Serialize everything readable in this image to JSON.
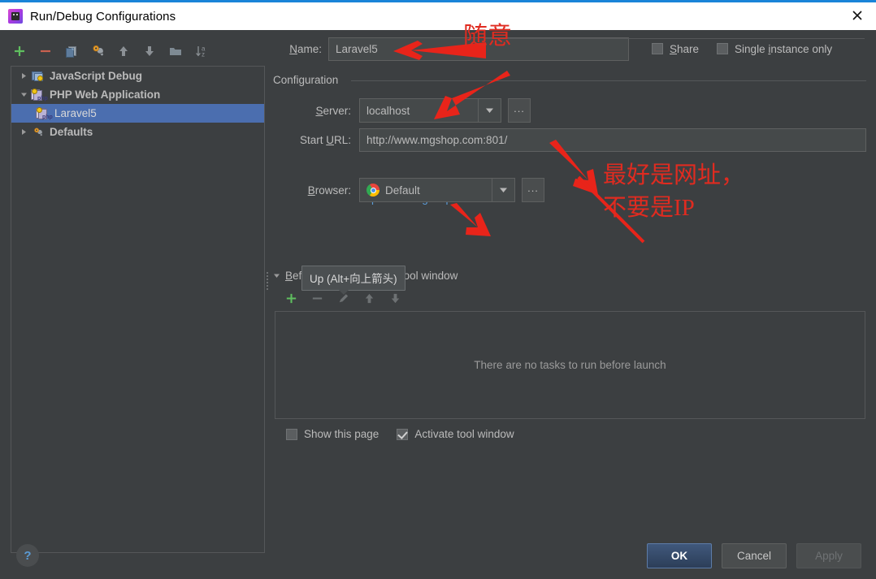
{
  "window": {
    "title": "Run/Debug Configurations",
    "icon": "phpstorm-icon",
    "close_icon": "close-icon"
  },
  "toolbar": {
    "buttons": [
      {
        "name": "add-configuration-button",
        "icon": "plus-icon"
      },
      {
        "name": "remove-configuration-button",
        "icon": "minus-icon"
      },
      {
        "name": "copy-configuration-button",
        "icon": "copy-icon"
      },
      {
        "name": "edit-defaults-button",
        "icon": "wrench-icon"
      },
      {
        "name": "move-up-button",
        "icon": "arrow-up-icon"
      },
      {
        "name": "move-down-button",
        "icon": "arrow-down-icon"
      },
      {
        "name": "create-folder-button",
        "icon": "folder-icon"
      },
      {
        "name": "sort-configurations-button",
        "icon": "sort-az-icon"
      }
    ]
  },
  "tree": {
    "items": [
      {
        "label": "JavaScript Debug",
        "icon": "javascript-debug-icon",
        "expanded": false,
        "selected": false,
        "indent": 0
      },
      {
        "label": "PHP Web Application",
        "icon": "php-web-application-icon",
        "expanded": true,
        "selected": false,
        "indent": 0
      },
      {
        "label": "Laravel5",
        "icon": "php-config-icon",
        "expanded": null,
        "selected": true,
        "indent": 1
      },
      {
        "label": "Defaults",
        "icon": "defaults-wrench-icon",
        "expanded": false,
        "selected": false,
        "indent": 0
      }
    ]
  },
  "form": {
    "name_label": "Name:",
    "name_mnemonic": "N",
    "name_value": "Laravel5",
    "share": {
      "label": "Share",
      "mnemonic": "S",
      "checked": false
    },
    "single_instance": {
      "label": "Single instance only",
      "mnemonic": "i",
      "checked": false
    },
    "group_title": "Configuration",
    "server": {
      "label": "Server:",
      "mnemonic": "S",
      "value": "localhost",
      "dropdown_icon": "chevron-down-icon",
      "browse_label": "..."
    },
    "start_url": {
      "label": "Start URL:",
      "mnemonic": "U",
      "value": "http://www.mgshop.com:801/",
      "link": "http://www.mgshop.com:801/"
    },
    "browser": {
      "label": "Browser:",
      "mnemonic": "B",
      "value": "Default",
      "icon": "chrome-icon",
      "dropdown_icon": "chevron-down-icon",
      "browse_label": "..."
    }
  },
  "before_launch": {
    "label": "Before launch: Activate tool window",
    "mnemonic": "B",
    "expanded": true,
    "toolbar": [
      {
        "name": "add-task-button",
        "icon": "plus-icon"
      },
      {
        "name": "remove-task-button",
        "icon": "minus-icon"
      },
      {
        "name": "edit-task-button",
        "icon": "pencil-icon"
      },
      {
        "name": "move-task-up-button",
        "icon": "arrow-up-icon"
      },
      {
        "name": "move-task-down-button",
        "icon": "arrow-down-icon"
      }
    ],
    "empty_text": "There are no tasks to run before launch",
    "show_this_page": {
      "label": "Show this page",
      "checked": false
    },
    "activate_tool_window": {
      "label": "Activate tool window",
      "checked": true
    }
  },
  "tooltip": {
    "text": "Up (Alt+向上箭头)"
  },
  "footer": {
    "help_label": "?",
    "ok_label": "OK",
    "cancel_label": "Cancel",
    "apply_label": "Apply",
    "apply_disabled": true
  },
  "annotations": {
    "color": "#e02b20",
    "note_name": "随意",
    "note_url_line1": "最好是网址，",
    "note_url_line2": "不要是IP"
  }
}
